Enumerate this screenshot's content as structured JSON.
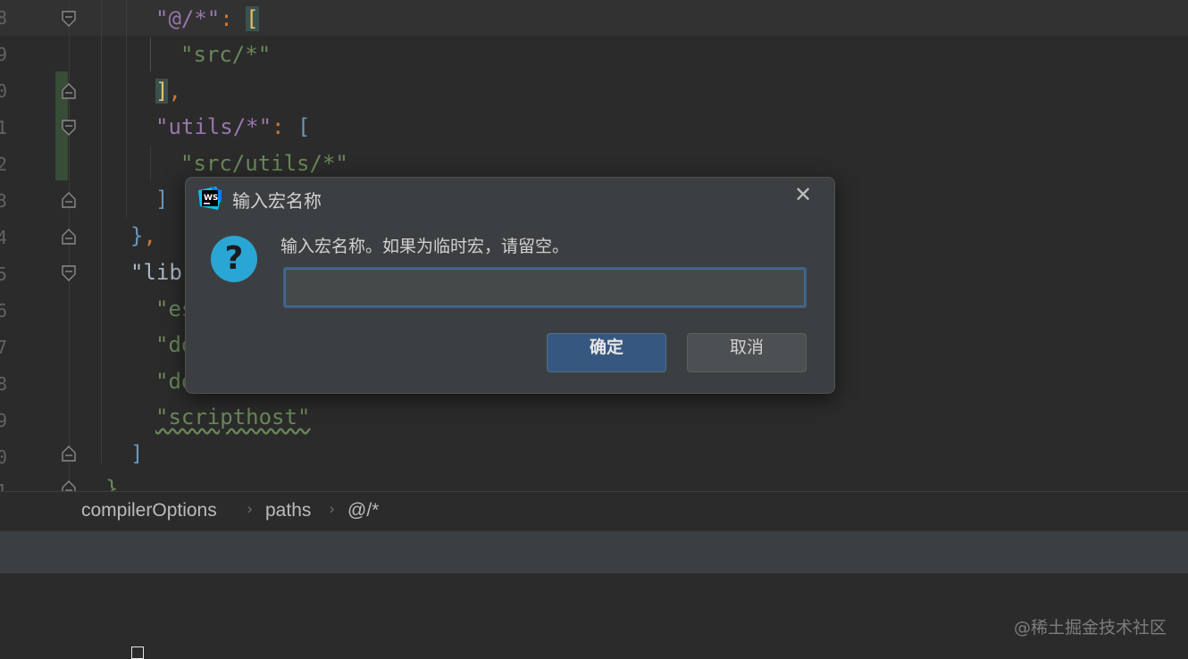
{
  "editor": {
    "line_numbers": [
      "8",
      "9",
      "0",
      "1",
      "2",
      "3",
      "4",
      "5",
      "6",
      "7",
      "8",
      "9",
      "0",
      "1"
    ],
    "lines": {
      "l1_key": "\"@/*\"",
      "l1_colon": ": ",
      "l1_bracket": "[",
      "l2": "\"src/*\"",
      "l3_bracket": "]",
      "l3_comma": ",",
      "l4_key": "\"utils/*\"",
      "l4_colon": ": ",
      "l4_bracket": "[",
      "l5": "\"src/utils/*\"",
      "l6_bracket": "]",
      "l7_brace": "}",
      "l7_comma": ",",
      "l8": "\"lib\"",
      "l9": "\"es",
      "l10": "\"do",
      "l11": "\"do",
      "l12": "\"scripthost\"",
      "l13_bracket": "]",
      "l14_brace": "}"
    }
  },
  "breadcrumb": {
    "items": [
      "compilerOptions",
      "paths",
      "@/*"
    ],
    "separator": "›"
  },
  "dialog": {
    "title": "输入宏名称",
    "message": "输入宏名称。如果为临时宏，请留空。",
    "input_value": "",
    "ok_label": "确定",
    "cancel_label": "取消",
    "close_glyph": "✕",
    "question_glyph": "?",
    "logo_text": "WS",
    "accent_color": "#2aa6d4"
  },
  "watermark": "@稀土掘金技术社区"
}
